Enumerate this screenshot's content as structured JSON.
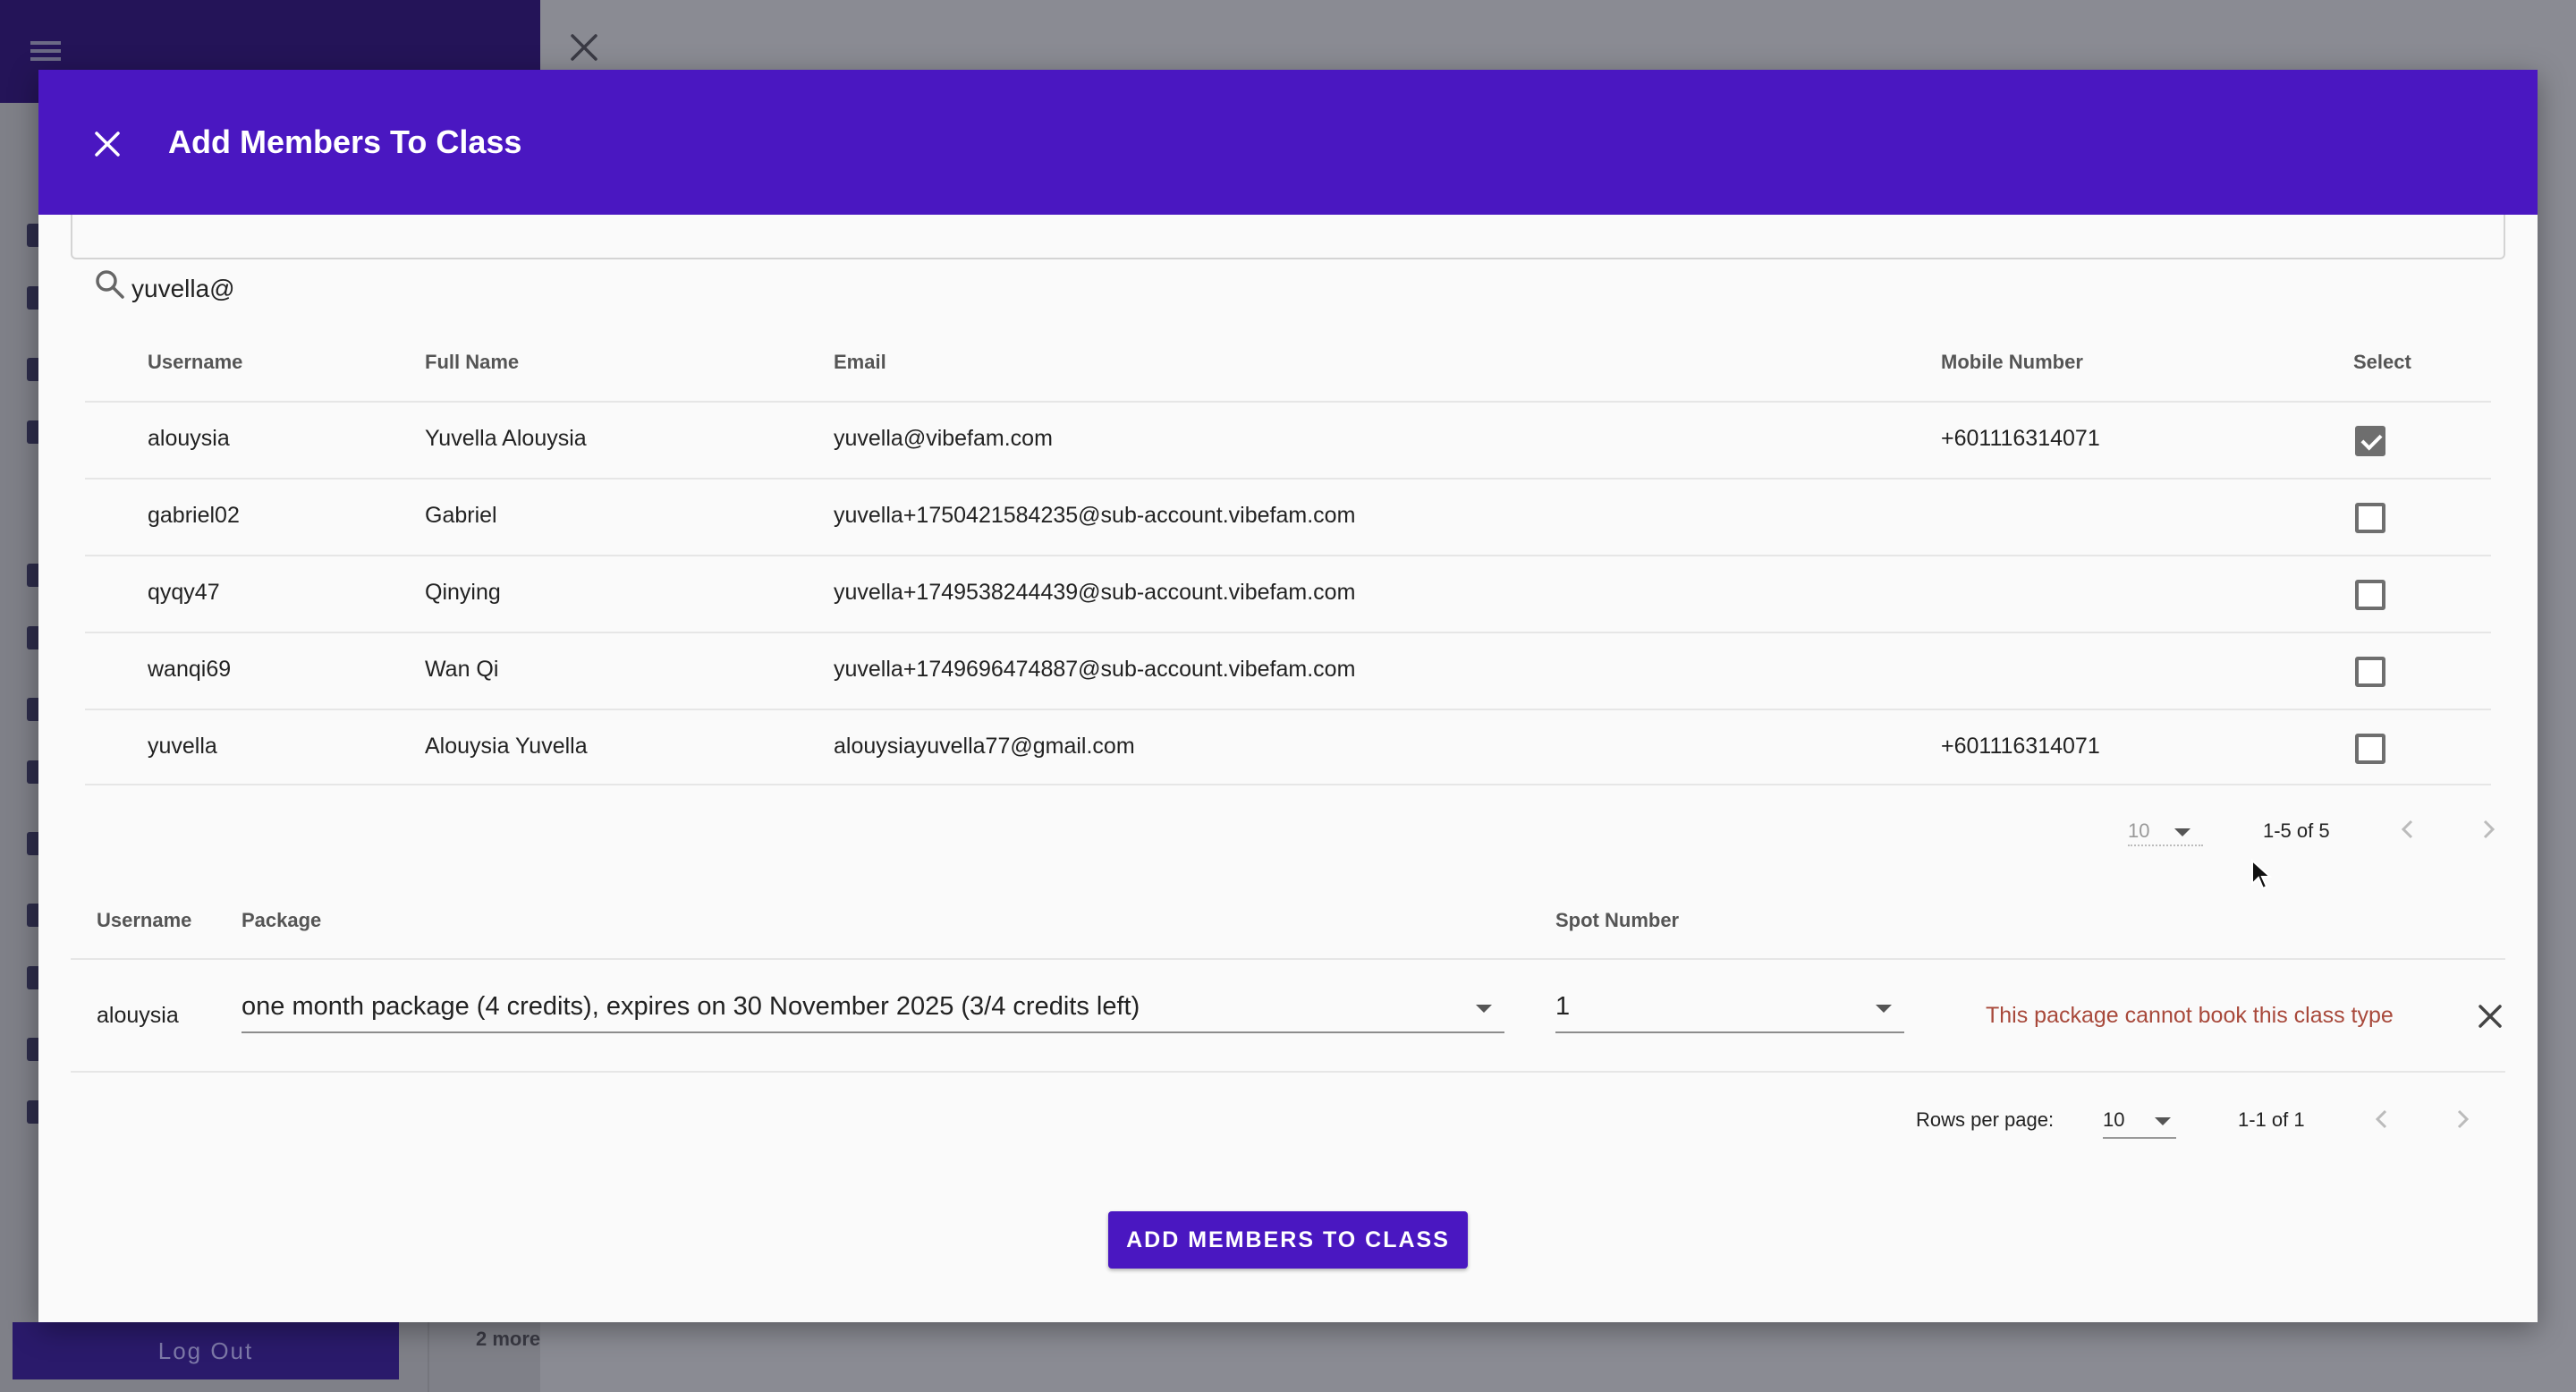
{
  "background": {
    "logout_label": "Log Out",
    "more_label": "2 more"
  },
  "modal": {
    "title": "Add Members To Class",
    "search": {
      "value": "yuvella@",
      "placeholder": ""
    },
    "members_table": {
      "headers": {
        "username": "Username",
        "full_name": "Full Name",
        "email": "Email",
        "mobile": "Mobile Number",
        "select": "Select"
      },
      "rows": [
        {
          "username": "alouysia",
          "full_name": "Yuvella Alouysia",
          "email": "yuvella@vibefam.com",
          "mobile": "+601116314071",
          "selected": true
        },
        {
          "username": "gabriel02",
          "full_name": "Gabriel",
          "email": "yuvella+1750421584235@sub-account.vibefam.com",
          "mobile": "",
          "selected": false
        },
        {
          "username": "qyqy47",
          "full_name": "Qinying",
          "email": "yuvella+1749538244439@sub-account.vibefam.com",
          "mobile": "",
          "selected": false
        },
        {
          "username": "wanqi69",
          "full_name": "Wan Qi",
          "email": "yuvella+1749696474887@sub-account.vibefam.com",
          "mobile": "",
          "selected": false
        },
        {
          "username": "yuvella",
          "full_name": "Alouysia Yuvella",
          "email": "alouysiayuvella77@gmail.com",
          "mobile": "+601116314071",
          "selected": false
        }
      ],
      "pagination": {
        "rows_per_page": "10",
        "range": "1-5 of 5"
      }
    },
    "selected_table": {
      "headers": {
        "username": "Username",
        "package": "Package",
        "spot": "Spot Number"
      },
      "rows": [
        {
          "username": "alouysia",
          "package": "one month package (4 credits), expires on 30 November 2025 (3/4 credits left)",
          "spot": "1",
          "error": "This package cannot book this class type"
        }
      ],
      "pagination": {
        "rows_per_page_label": "Rows per page:",
        "rows_per_page": "10",
        "range": "1-1 of 1"
      }
    },
    "submit_label": "ADD MEMBERS TO CLASS"
  },
  "colors": {
    "primary": "#4a17c1",
    "error": "#a8493b"
  }
}
